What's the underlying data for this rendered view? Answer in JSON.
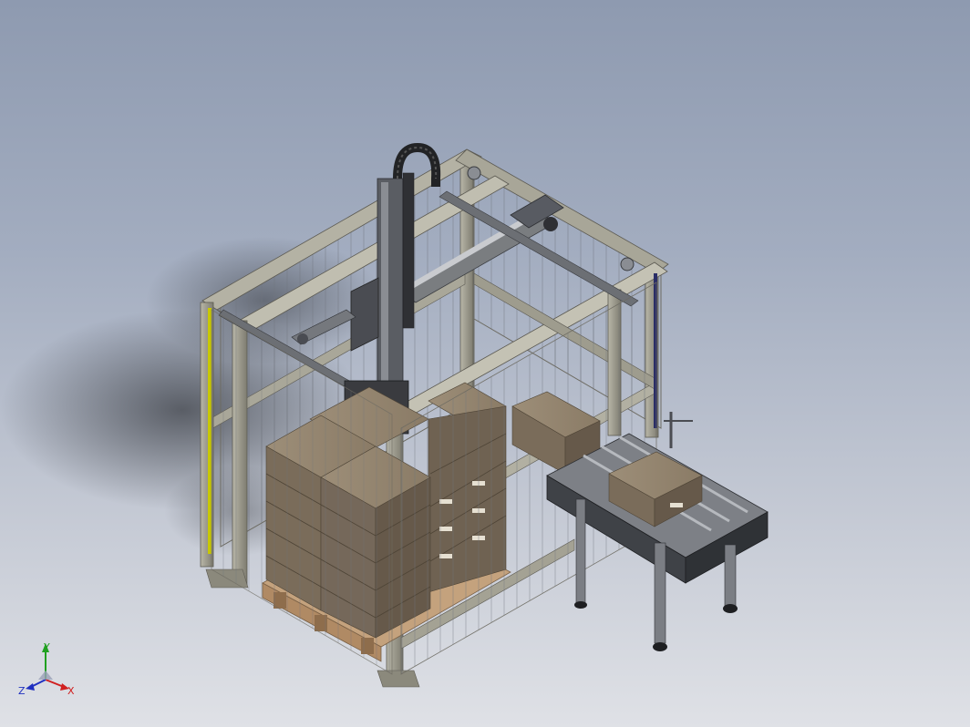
{
  "viewport": {
    "background_top": "#8e9ab0",
    "background_bottom": "#dfe1e6"
  },
  "model": {
    "frame_color": "#9c9a8c",
    "box_color": "#8d7d68",
    "pallet_color": "#c4a27d",
    "conveyor_color": "#4a4d52",
    "light_curtain_color": "#c8c800"
  },
  "triad": {
    "x_label": "X",
    "y_label": "Y",
    "z_label": "Z",
    "x_color": "#d02020",
    "y_color": "#20a020",
    "z_color": "#2030c0"
  }
}
